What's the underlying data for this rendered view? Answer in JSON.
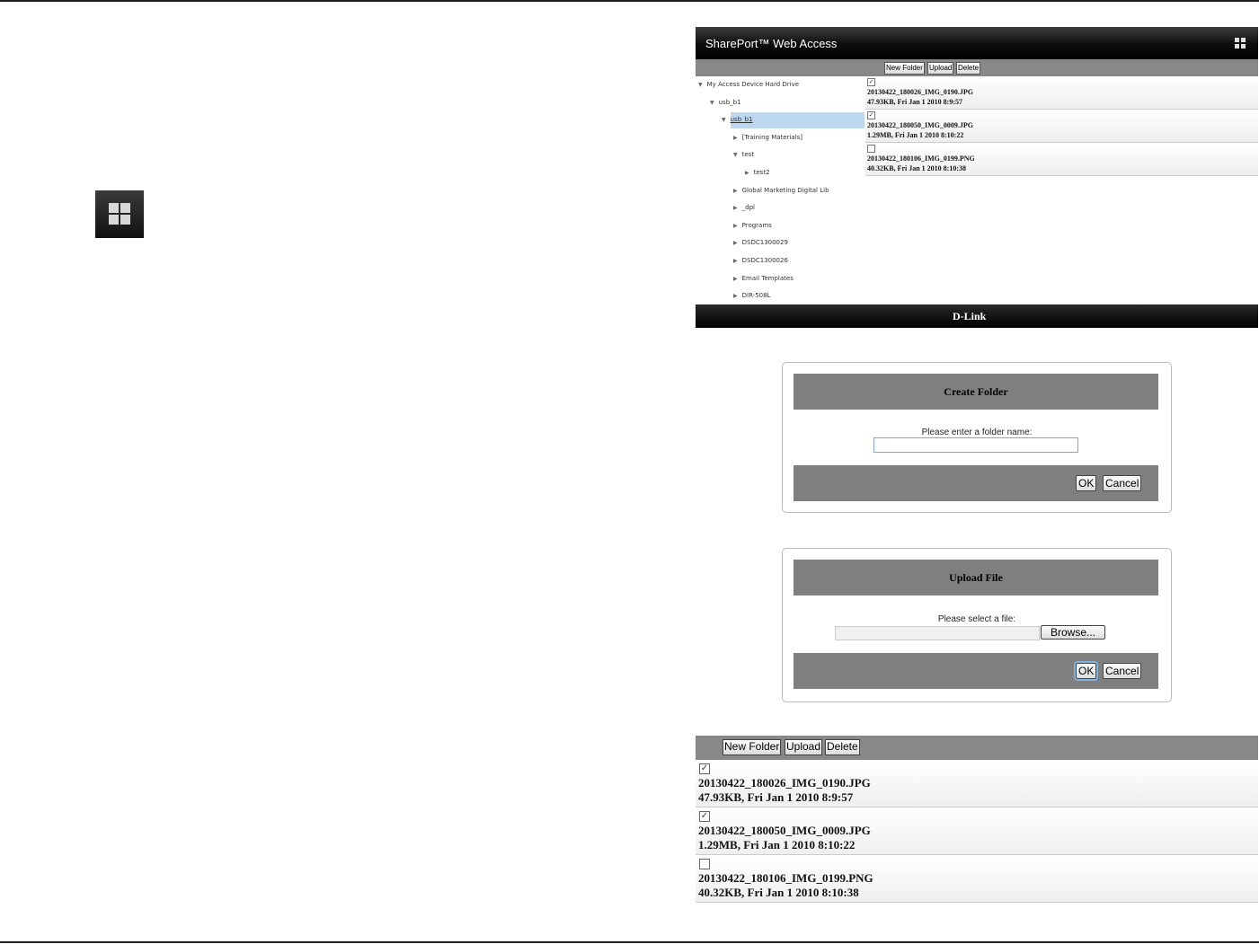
{
  "app": {
    "title": "SharePort™ Web Access",
    "brand": "D-Link",
    "toolbar": {
      "new_folder": "New Folder",
      "upload": "Upload",
      "delete": "Delete"
    },
    "tree": [
      {
        "label": "My Access Device Hard Drive",
        "expanded": true
      },
      {
        "label": "usb_b1",
        "expanded": true
      },
      {
        "label": "usb_b1",
        "expanded": true,
        "selected": true
      },
      {
        "label": "[Training Materials]",
        "expanded": false
      },
      {
        "label": "test",
        "expanded": true
      },
      {
        "label": "test2",
        "expanded": false
      },
      {
        "label": "Global Marketing Digital Lib",
        "expanded": false
      },
      {
        "label": "_dpl",
        "expanded": false
      },
      {
        "label": "Programs",
        "expanded": false
      },
      {
        "label": "DSDC1300029",
        "expanded": false
      },
      {
        "label": "DSDC1300026",
        "expanded": false
      },
      {
        "label": "Email Templates",
        "expanded": false
      },
      {
        "label": "DIR-508L",
        "expanded": false
      }
    ],
    "files": [
      {
        "name": "20130422_180026_IMG_0190.JPG",
        "meta": "47.93KB, Fri Jan 1 2010 8:9:57",
        "checked": true
      },
      {
        "name": "20130422_180050_IMG_0009.JPG",
        "meta": "1.29MB, Fri Jan 1 2010 8:10:22",
        "checked": true
      },
      {
        "name": "20130422_180106_IMG_0199.PNG",
        "meta": "40.32KB, Fri Jan 1 2010 8:10:38",
        "checked": false
      }
    ]
  },
  "create_folder": {
    "title": "Create Folder",
    "label": "Please enter a folder name:",
    "value": "",
    "ok": "OK",
    "cancel": "Cancel"
  },
  "upload_file": {
    "title": "Upload File",
    "label": "Please select a file:",
    "browse": "Browse...",
    "ok": "OK",
    "cancel": "Cancel"
  },
  "icons": {
    "grid": "grid-icon",
    "check": "✓",
    "expanded": "▼",
    "collapsed": "▶"
  },
  "colors": {
    "toolbar": "#888888",
    "header": "#000000",
    "selection": "#bcd7f0"
  }
}
